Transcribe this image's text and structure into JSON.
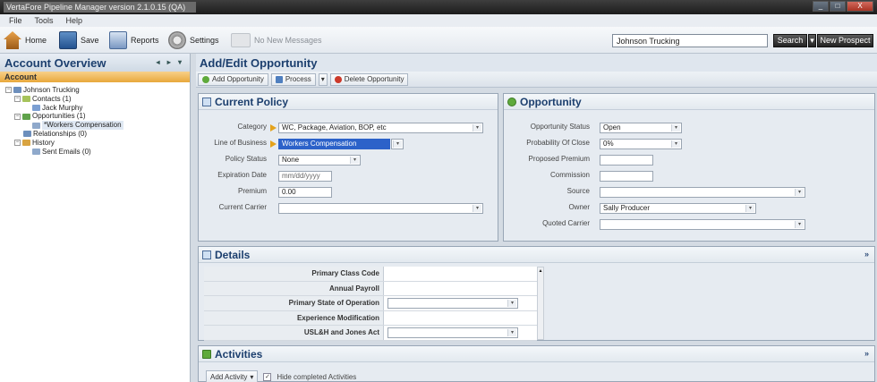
{
  "window": {
    "title": "VertaFore Pipeline Manager version 2.1.0.15 (QA)",
    "minimize": "_",
    "maximize": "□",
    "close": "X"
  },
  "menu": [
    "File",
    "Tools",
    "Help"
  ],
  "toolbar": {
    "home": "Home",
    "save": "Save",
    "reports": "Reports",
    "settings": "Settings",
    "messages": "No New Messages",
    "search_value": "Johnson Trucking",
    "search_button": "Search",
    "search_menu": "▾",
    "new_prospect": "New Prospect"
  },
  "sidebar": {
    "title": "Account Overview",
    "nav": "◂ ▸ ▾",
    "tab": "Account",
    "tree": {
      "root": "Johnson Trucking",
      "contacts": "Contacts (1)",
      "contact_1": "Jack Murphy",
      "opportunities": "Opportunities (1)",
      "opportunity_1": "*Workers Compensation",
      "relationships": "Relationships (0)",
      "history": "History",
      "sent_emails": "Sent Emails (0)"
    }
  },
  "main": {
    "title": "Add/Edit Opportunity",
    "actions": {
      "add": "Add Opportunity",
      "process": "Process",
      "process_menu": "▾",
      "delete": "Delete Opportunity"
    }
  },
  "current_policy": {
    "title": "Current Policy",
    "category_label": "Category",
    "category_value": "WC, Package, Aviation, BOP, etc",
    "lob_label": "Line of Business",
    "lob_value": "Workers Compensation",
    "status_label": "Policy Status",
    "status_value": "None",
    "exp_label": "Expiration Date",
    "exp_value": "mm/dd/yyyy",
    "premium_label": "Premium",
    "premium_value": "0.00",
    "carrier_label": "Current Carrier",
    "carrier_value": ""
  },
  "opportunity": {
    "title": "Opportunity",
    "status_label": "Opportunity Status",
    "status_value": "Open",
    "prob_label": "Probability Of Close",
    "prob_value": "0%",
    "proposed_label": "Proposed Premium",
    "proposed_value": "",
    "commission_label": "Commission",
    "commission_value": "",
    "source_label": "Source",
    "source_value": "",
    "owner_label": "Owner",
    "owner_value": "Sally Producer",
    "quoted_label": "Quoted Carrier",
    "quoted_value": ""
  },
  "details": {
    "title": "Details",
    "collapse": "»",
    "rows": [
      "Primary Class Code",
      "Annual Payroll",
      "Primary State of Operation",
      "Experience Modification",
      "USL&H and Jones Act"
    ]
  },
  "activities": {
    "title": "Activities",
    "collapse": "»",
    "add": "Add Activity",
    "hide_completed": "Hide completed Activities"
  },
  "colors": {
    "accent": "#1c3f6e",
    "selected_tab": "#e8a83c",
    "highlight": "#2c62c9"
  }
}
